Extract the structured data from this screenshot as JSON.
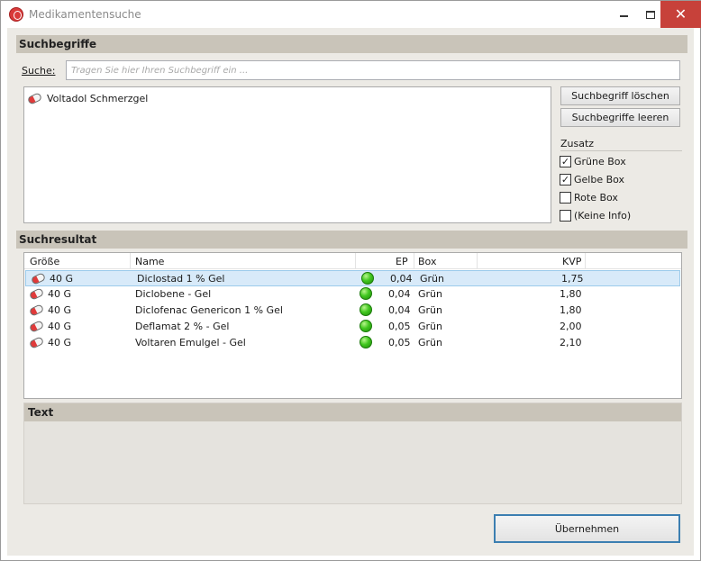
{
  "window": {
    "title": "Medikamentensuche",
    "close_glyph": "✕"
  },
  "suchbegriffe": {
    "header": "Suchbegriffe",
    "search_label": "Suche:",
    "search_placeholder": "Tragen Sie hier Ihren Suchbegriff ein ...",
    "search_value": "",
    "terms": [
      "Voltadol Schmerzgel"
    ],
    "btn_delete": "Suchbegriff löschen",
    "btn_clear": "Suchbegriffe leeren",
    "zusatz_label": "Zusatz",
    "checkboxes": [
      {
        "label": "Grüne Box",
        "checked": true
      },
      {
        "label": "Gelbe Box",
        "checked": true
      },
      {
        "label": "Rote Box",
        "checked": false
      },
      {
        "label": "(Keine Info)",
        "checked": false
      }
    ]
  },
  "suchresultat": {
    "header": "Suchresultat",
    "columns": [
      "Größe",
      "Name",
      "EP",
      "Box",
      "KVP"
    ],
    "rows": [
      {
        "size": "40 G",
        "name": "Diclostad 1 % Gel",
        "ep": "0,04",
        "box": "Grün",
        "kvp": "1,75",
        "selected": true
      },
      {
        "size": "40 G",
        "name": "Diclobene - Gel",
        "ep": "0,04",
        "box": "Grün",
        "kvp": "1,80",
        "selected": false
      },
      {
        "size": "40 G",
        "name": "Diclofenac Genericon 1 % Gel",
        "ep": "0,04",
        "box": "Grün",
        "kvp": "1,80",
        "selected": false
      },
      {
        "size": "40 G",
        "name": "Deflamat 2 % - Gel",
        "ep": "0,05",
        "box": "Grün",
        "kvp": "2,00",
        "selected": false
      },
      {
        "size": "40 G",
        "name": "Voltaren Emulgel - Gel",
        "ep": "0,05",
        "box": "Grün",
        "kvp": "2,10",
        "selected": false
      }
    ]
  },
  "text_panel": {
    "header": "Text"
  },
  "footer": {
    "accept_label": "Übernehmen"
  },
  "colors": {
    "section_header_bg": "#c9c4b9",
    "selected_row_bg": "#d8eaf9",
    "status_green": "#42c820",
    "close_button_bg": "#c7413a",
    "accent_border": "#3c7fb1"
  }
}
